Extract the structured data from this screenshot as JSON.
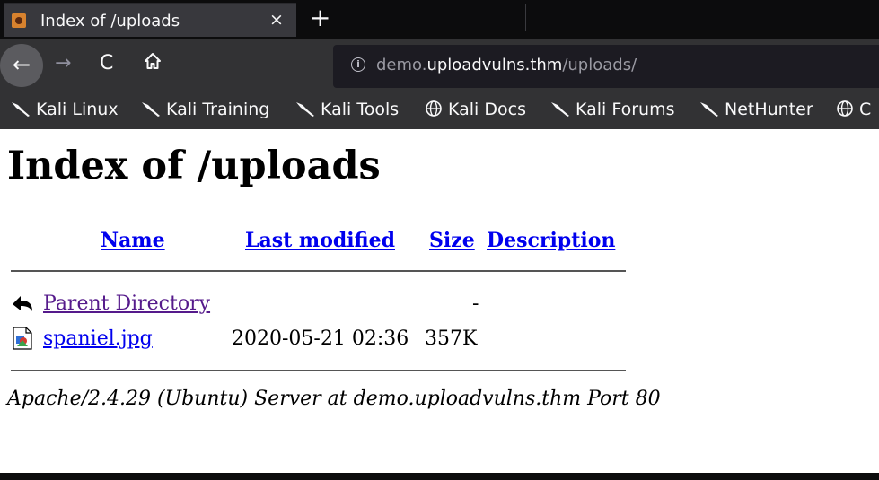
{
  "tab": {
    "title": "Index of /uploads",
    "close": "×",
    "new_tab": "+"
  },
  "nav": {
    "back": "←",
    "forward": "→",
    "reload": "C",
    "url": {
      "prefix": "demo.",
      "domain": "uploadvulns.thm",
      "path": "/uploads/"
    }
  },
  "bookmarks": [
    {
      "label": "Kali Linux",
      "icon": "kali-dragon-icon"
    },
    {
      "label": "Kali Training",
      "icon": "kali-dragon-icon"
    },
    {
      "label": "Kali Tools",
      "icon": "kali-dragon-icon"
    },
    {
      "label": "Kali Docs",
      "icon": "globe-icon"
    },
    {
      "label": "Kali Forums",
      "icon": "kali-dragon-icon"
    },
    {
      "label": "NetHunter",
      "icon": "kali-dragon-icon"
    },
    {
      "label": "C",
      "icon": "globe-icon"
    }
  ],
  "page": {
    "heading": "Index of /uploads",
    "columns": {
      "name": "Name",
      "last_modified": "Last modified",
      "size": "Size",
      "description": "Description"
    },
    "rows": [
      {
        "name": "Parent Directory",
        "last_modified": "",
        "size": "-",
        "icon": "back-arrow-icon"
      },
      {
        "name": "spaniel.jpg",
        "last_modified": "2020-05-21 02:36",
        "size": "357K",
        "icon": "image-file-icon"
      }
    ],
    "footer": "Apache/2.4.29 (Ubuntu) Server at demo.uploadvulns.thm Port 80"
  },
  "colors": {
    "link": "#0000ee",
    "visited": "#551a8b",
    "chrome": "#323234",
    "tab_active": "#38383d"
  }
}
